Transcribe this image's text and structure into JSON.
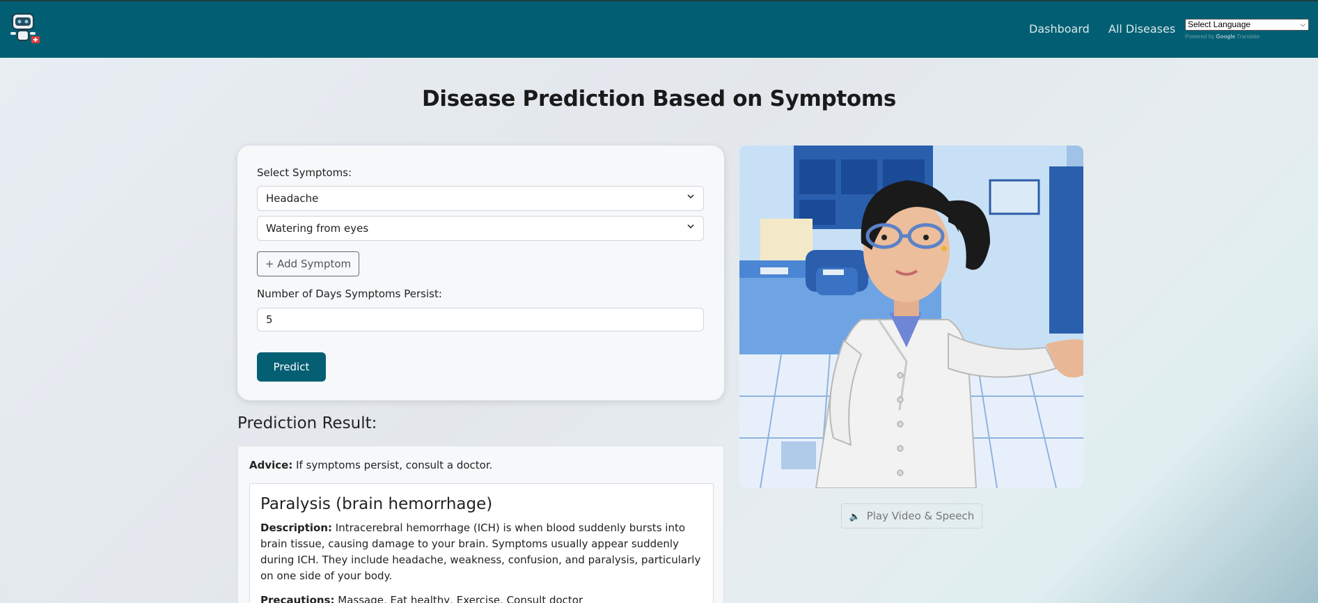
{
  "nav": {
    "links": [
      "Dashboard",
      "All Diseases"
    ],
    "language_select": "Select Language",
    "powered_by": "Powered by",
    "google": "Google",
    "translate": "Translate"
  },
  "page_title": "Disease Prediction Based on Symptoms",
  "form": {
    "symptoms_label": "Select Symptoms:",
    "symptoms": [
      "Headache",
      "Watering from eyes"
    ],
    "add_symptom_label": "+ Add Symptom",
    "days_label": "Number of Days Symptoms Persist:",
    "days_value": "5",
    "predict_label": "Predict"
  },
  "result": {
    "heading": "Prediction Result:",
    "advice_label": "Advice:",
    "advice_text": "If symptoms persist, consult a doctor.",
    "disease_name": "Paralysis (brain hemorrhage)",
    "description_label": "Description:",
    "description_text": "Intracerebral hemorrhage (ICH) is when blood suddenly bursts into brain tissue, causing damage to your brain. Symptoms usually appear suddenly during ICH. They include headache, weakness, confusion, and paralysis, particularly on one side of your body.",
    "precautions_label": "Precautions:",
    "precautions_text": "Massage, Eat healthy, Exercise, Consult doctor"
  },
  "media": {
    "play_label": "Play Video & Speech",
    "speaker_icon": "speaker-icon"
  },
  "colors": {
    "navbar": "#025f73",
    "primary_button": "#045f73"
  }
}
